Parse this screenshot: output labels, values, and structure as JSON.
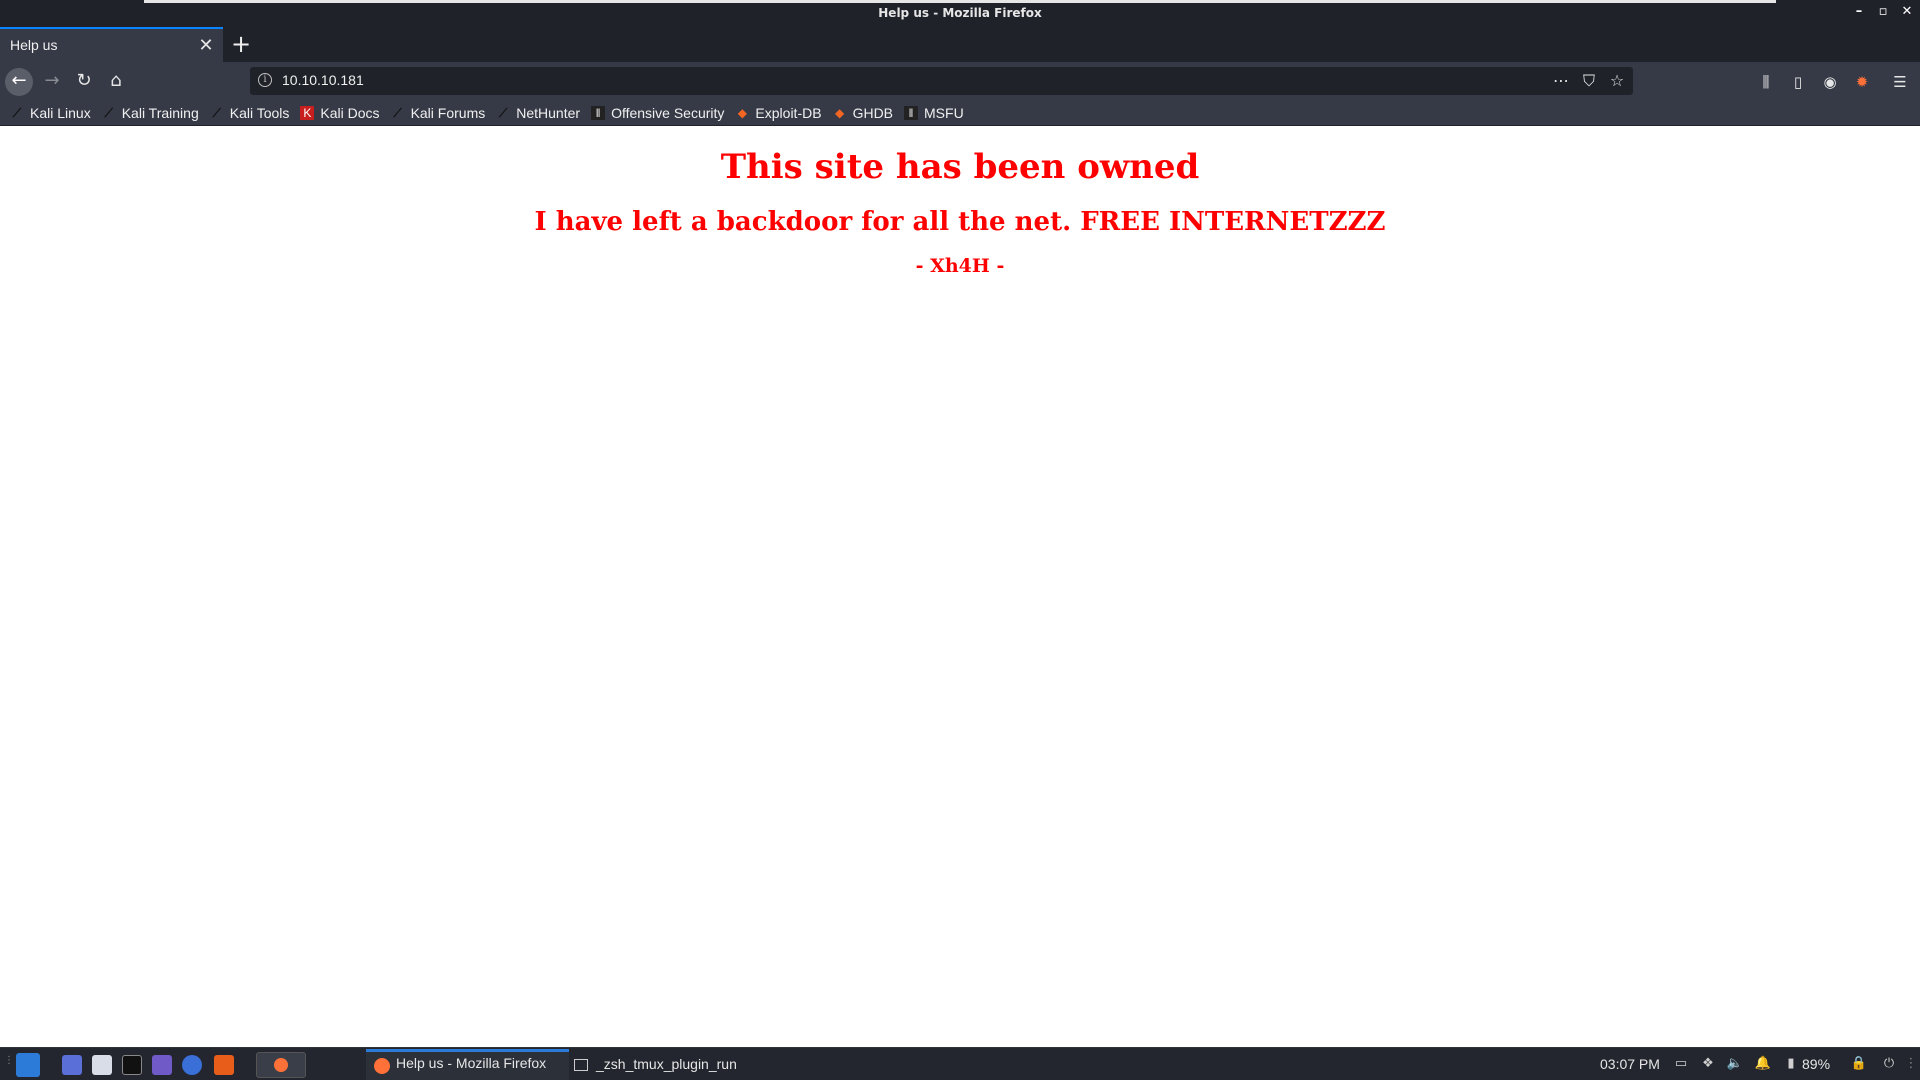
{
  "window": {
    "title": "Help us - Mozilla Firefox"
  },
  "tab": {
    "label": "Help us"
  },
  "address_bar": {
    "url": "10.10.10.181"
  },
  "bookmarks": [
    {
      "label": "Kali Linux",
      "icon": "kali-dragon-icon"
    },
    {
      "label": "Kali Training",
      "icon": "kali-dragon-icon"
    },
    {
      "label": "Kali Tools",
      "icon": "kali-dragon-icon"
    },
    {
      "label": "Kali Docs",
      "icon": "kali-docs-icon"
    },
    {
      "label": "Kali Forums",
      "icon": "kali-dragon-icon"
    },
    {
      "label": "NetHunter",
      "icon": "kali-dragon-icon"
    },
    {
      "label": "Offensive Security",
      "icon": "offsec-icon"
    },
    {
      "label": "Exploit-DB",
      "icon": "exploit-db-icon"
    },
    {
      "label": "GHDB",
      "icon": "exploit-db-icon"
    },
    {
      "label": "MSFU",
      "icon": "offsec-icon"
    }
  ],
  "page": {
    "heading": "This site has been owned",
    "subheading": "I have left a backdoor for all the net. FREE INTERNETZZZ",
    "signature": "- Xh4H -",
    "text_color": "#ff0000"
  },
  "taskbar": {
    "firefox_task": "Help us - Mozilla Firefox",
    "terminal_task": "_zsh_tmux_plugin_run",
    "time": "03:07 PM",
    "battery": "89%"
  }
}
